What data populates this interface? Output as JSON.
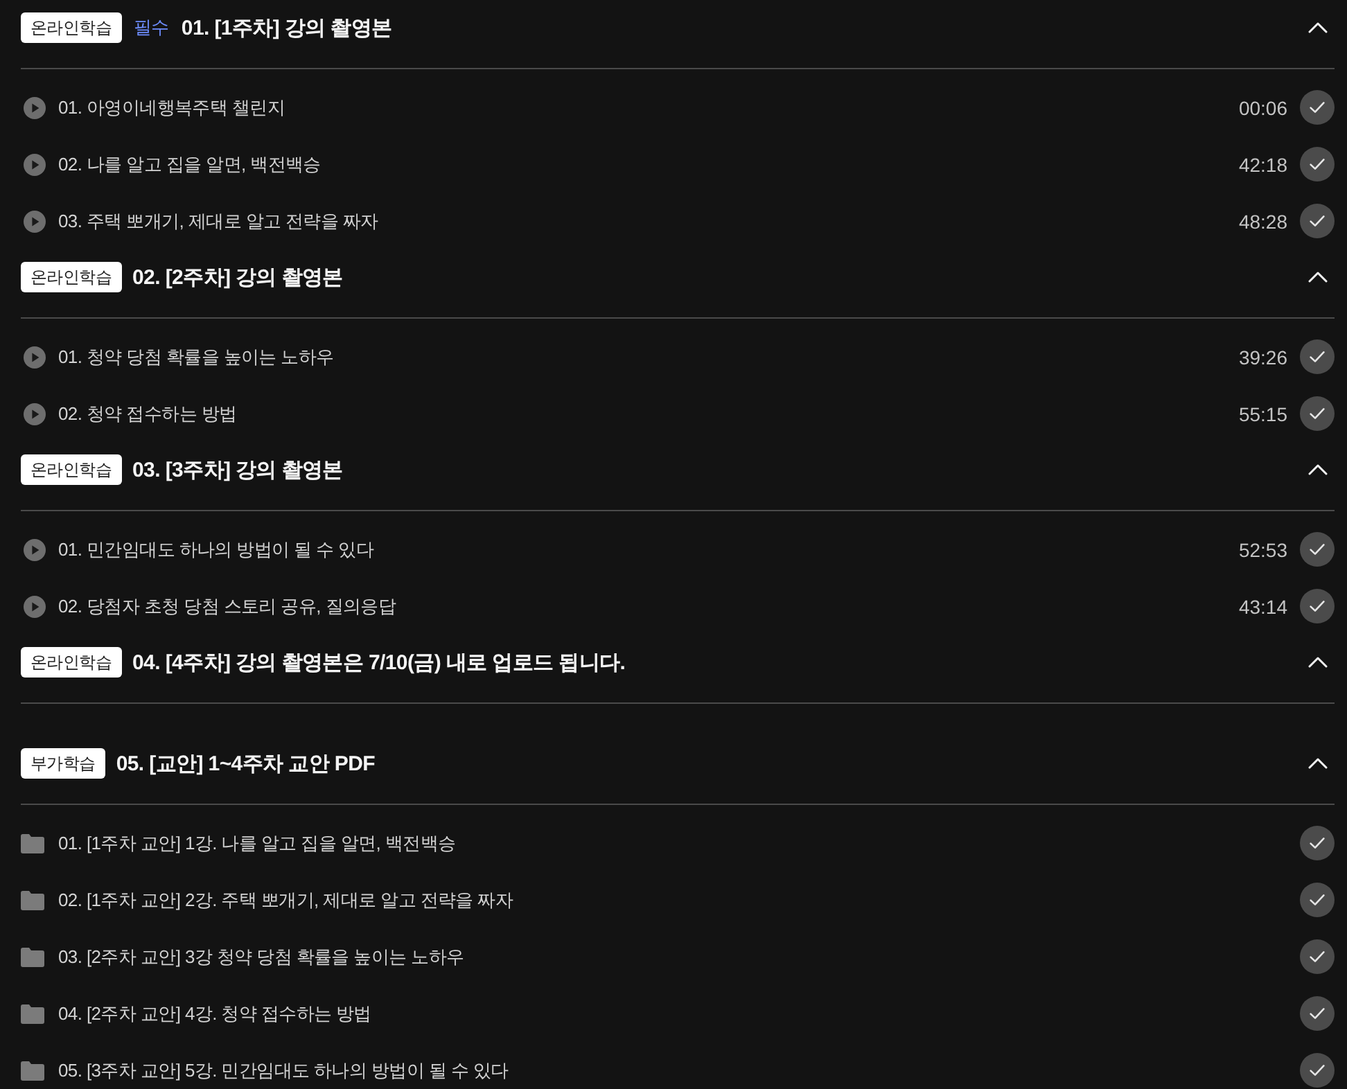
{
  "sections": [
    {
      "badge": "온라인학습",
      "required_label": "필수",
      "title": "01. [1주차] 강의 촬영본",
      "expanded": true,
      "items": [
        {
          "kind": "video",
          "title": "01. 아영이네행복주택 챌린지",
          "duration": "00:06",
          "completed": true
        },
        {
          "kind": "video",
          "title": "02. 나를 알고 집을 알면, 백전백승",
          "duration": "42:18",
          "completed": true
        },
        {
          "kind": "video",
          "title": "03. 주택 뽀개기, 제대로 알고 전략을 짜자",
          "duration": "48:28",
          "completed": true
        }
      ]
    },
    {
      "badge": "온라인학습",
      "title": "02. [2주차] 강의 촬영본",
      "expanded": true,
      "items": [
        {
          "kind": "video",
          "title": "01. 청약 당첨 확률을 높이는 노하우",
          "duration": "39:26",
          "completed": true
        },
        {
          "kind": "video",
          "title": "02. 청약 접수하는 방법",
          "duration": "55:15",
          "completed": true
        }
      ]
    },
    {
      "badge": "온라인학습",
      "title": "03. [3주차] 강의 촬영본",
      "expanded": true,
      "items": [
        {
          "kind": "video",
          "title": "01. 민간임대도 하나의 방법이 될 수 있다",
          "duration": "52:53",
          "completed": true
        },
        {
          "kind": "video",
          "title": "02. 당첨자 초청 당첨 스토리 공유, 질의응답",
          "duration": "43:14",
          "completed": true
        }
      ]
    },
    {
      "badge": "온라인학습",
      "title": "04. [4주차] 강의 촬영본은 7/10(금) 내로 업로드 됩니다.",
      "expanded": true
    },
    {
      "badge": "부가학습",
      "title": "05. [교안] 1~4주차 교안 PDF",
      "expanded": true,
      "items": [
        {
          "kind": "file",
          "title": "01. [1주차 교안] 1강. 나를 알고 집을 알면, 백전백승",
          "completed": true
        },
        {
          "kind": "file",
          "title": "02. [1주차 교안] 2강. 주택 뽀개기, 제대로 알고 전략을 짜자",
          "completed": true
        },
        {
          "kind": "file",
          "title": "03. [2주차 교안] 3강 청약 당첨 확률을 높이는 노하우",
          "completed": true
        },
        {
          "kind": "file",
          "title": "04. [2주차 교안] 4강. 청약 접수하는 방법",
          "completed": true
        },
        {
          "kind": "file",
          "title": "05. [3주차 교안] 5강. 민간임대도 하나의 방법이 될 수 있다",
          "completed": true
        }
      ]
    }
  ]
}
